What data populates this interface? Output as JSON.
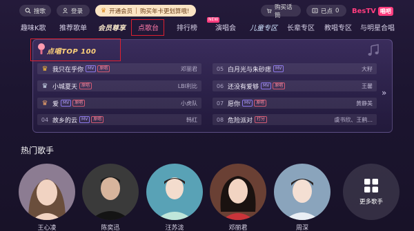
{
  "topbar": {
    "search_label": "搜歌",
    "login_label": "登录",
    "vip_open": "开通会员",
    "vip_promo": "购买年卡更划算哦!",
    "buy_mic": "购买话筒",
    "points": "已点",
    "points_count": "0",
    "brand": "BesTV",
    "brand_tag": "唱吧"
  },
  "nav": {
    "items": [
      "趣味K歌",
      "推荐歌单",
      "会员尊享",
      "点歌台",
      "排行榜",
      "演唱会",
      "儿童专区",
      "长辈专区",
      "教唱专区",
      "与明星合唱"
    ],
    "new_badge": "NEW"
  },
  "top100": {
    "title": "点唱TOP 100",
    "tag_mv": "MV",
    "tag_orig": "原唱",
    "left": [
      {
        "rank": "01",
        "title": "我只在乎你",
        "tags": [
          "MV",
          "原唱"
        ],
        "singer": "邓丽君"
      },
      {
        "rank": "02",
        "title": "小城夏天",
        "tags": [
          "原唱"
        ],
        "singer": "LBI利比"
      },
      {
        "rank": "03",
        "title": "爱",
        "tags": [
          "MV",
          "原唱"
        ],
        "singer": "小虎队"
      },
      {
        "rank": "04",
        "title": "故乡的云",
        "tags": [
          "MV",
          "原唱"
        ],
        "singer": "韩红"
      }
    ],
    "right": [
      {
        "rank": "05",
        "title": "白月光与朱砂痣",
        "tags": [
          "MV"
        ],
        "singer": "大籽"
      },
      {
        "rank": "06",
        "title": "还没有爱够",
        "tags": [
          "MV",
          "原唱"
        ],
        "singer": "王馨"
      },
      {
        "rank": "07",
        "title": "愿你",
        "tags": [
          "MV",
          "原唱"
        ],
        "singer": "黄静美"
      },
      {
        "rank": "08",
        "title": "危险派对",
        "tags": [
          "打分"
        ],
        "singer": "虞书欣、王鹤..."
      }
    ]
  },
  "hot_singers": {
    "title": "热门歌手",
    "items": [
      {
        "name": "王心凌",
        "bg": "#7a6a80"
      },
      {
        "name": "陈奕迅",
        "bg": "#3a3a3a"
      },
      {
        "name": "汪苏泷",
        "bg": "#4a8aa0"
      },
      {
        "name": "邓丽君",
        "bg": "#5a3a30"
      },
      {
        "name": "周深",
        "bg": "#7a90a8"
      }
    ],
    "more_label": "更多歌手"
  },
  "colors": {
    "accent": "#ff3d7f",
    "gold": "#ffd27a",
    "highlight_box": "#e02030"
  }
}
